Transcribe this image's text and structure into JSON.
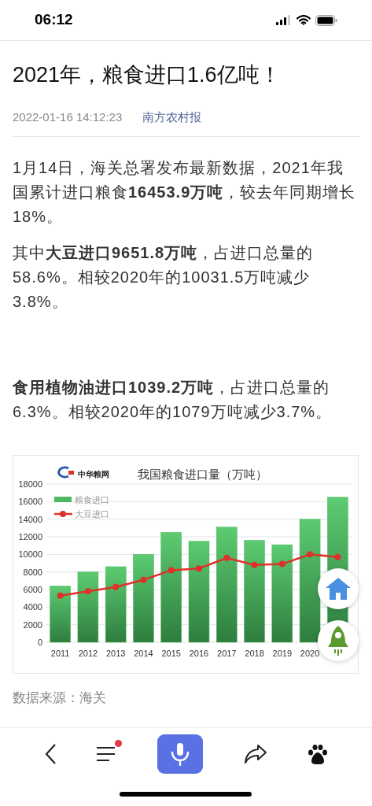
{
  "status_bar": {
    "time": "06:12"
  },
  "article": {
    "title": "2021年，粮食进口1.6亿吨！",
    "date": "2022-01-16 14:12:23",
    "source": "南方农村报",
    "paragraphs": [
      "1月14日，海关总署发布最新数据，2021年我国累计进口粮食**16453.9万吨**，较去年同期增长18%。",
      "其中**大豆进口9651.8万吨**，占进口总量的58.6%。相较2020年的10031.5万吨减少3.8%。",
      "**食用植物油进口1039.2万吨**，占进口总量的6.3%。相较2020年的1079万吨减少3.7%。"
    ],
    "figure": {
      "logo": "中华粮网",
      "chart_data": {
        "type": "bar",
        "title": "我国粮食进口量（万吨）",
        "categories": [
          "2011",
          "2012",
          "2013",
          "2014",
          "2015",
          "2016",
          "2017",
          "2018",
          "2019",
          "2020",
          null
        ],
        "stacked": false,
        "grid": true,
        "legend": true,
        "series": [
          {
            "name": "粮食进口",
            "type": "bar",
            "color": "#4cb861",
            "values": [
              6400,
              8000,
              8600,
              10000,
              12500,
              11500,
              13100,
              11600,
              11100,
              14000,
              16500
            ]
          },
          {
            "name": "大豆进口",
            "type": "line",
            "marker": "circle",
            "color": "#e0302a",
            "values": [
              5300,
              5800,
              6300,
              7100,
              8200,
              8400,
              9600,
              8800,
              8900,
              10000,
              9700
            ]
          }
        ],
        "ylim": [
          0,
          18000
        ],
        "yticks": [
          0,
          2000,
          4000,
          6000,
          8000,
          10000,
          12000,
          14000,
          16000,
          18000
        ]
      }
    },
    "caption": "数据来源：海关"
  },
  "toolbar": {
    "menu_notification": true
  }
}
